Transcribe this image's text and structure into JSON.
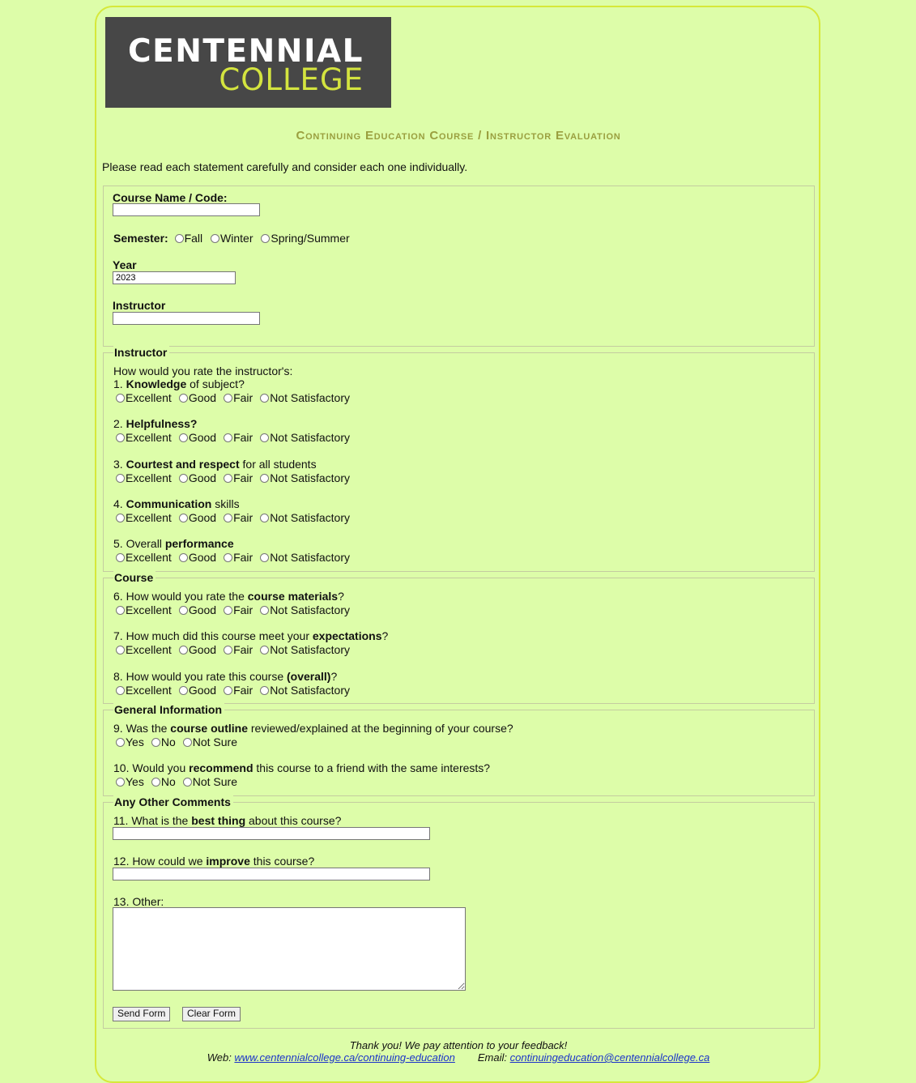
{
  "logo": {
    "line1": "CENTENNIAL",
    "line2": "COLLEGE"
  },
  "title": "Continuing Education Course / Instructor Evaluation",
  "intro": "Please read each statement carefully and consider each one individually.",
  "course_info": {
    "course_name_label": "Course Name / Code:",
    "semester_label": "Semester:",
    "semester_options": [
      "Fall",
      "Winter",
      "Spring/Summer"
    ],
    "year_label": "Year",
    "year_value": "2023",
    "instructor_label": "Instructor"
  },
  "ratings": [
    "Excellent",
    "Good",
    "Fair",
    "Not Satisfactory"
  ],
  "yes_no": [
    "Yes",
    "No",
    "Not Sure"
  ],
  "instructor_section": {
    "legend": "Instructor",
    "prompt": "How would you rate the instructor's:",
    "q1": {
      "num": "1. ",
      "bold": "Knowledge",
      "rest": " of subject?"
    },
    "q2": {
      "num": "2. ",
      "bold": "Helpfulness?",
      "rest": ""
    },
    "q3": {
      "num": "3. ",
      "bold": "Courtest and respect",
      "rest": " for all students"
    },
    "q4": {
      "num": "4. ",
      "bold": "Communication",
      "rest": " skills"
    },
    "q5": {
      "num": "5. Overall ",
      "bold": "performance",
      "rest": ""
    }
  },
  "course_section": {
    "legend": "Course",
    "q6": {
      "num": "6. How would you rate the ",
      "bold": "course materials",
      "rest": "?"
    },
    "q7": {
      "num": "7. How much did this course meet your ",
      "bold": "expectations",
      "rest": "?"
    },
    "q8": {
      "num": "8. How would you rate this course ",
      "bold": "(overall)",
      "rest": "?"
    }
  },
  "general_section": {
    "legend": "General Information",
    "q9": {
      "num": "9. Was the ",
      "bold": "course outline",
      "rest": " reviewed/explained at the beginning of your course?"
    },
    "q10": {
      "num": "10. Would you ",
      "bold": "recommend",
      "rest": " this course to a friend with the same interests?"
    }
  },
  "comments_section": {
    "legend": "Any Other Comments",
    "q11": {
      "num": "11. What is the ",
      "bold": "best thing",
      "rest": " about this course?"
    },
    "q12": {
      "num": "12. How could we ",
      "bold": "improve",
      "rest": " this course?"
    },
    "q13": "13. Other:"
  },
  "buttons": {
    "send": "Send Form",
    "clear": "Clear Form"
  },
  "footer": {
    "thanks": "Thank you! We pay attention to your feedback!",
    "web_label": "Web: ",
    "web_url": "www.centennialcollege.ca/continuing-education",
    "email_label": "Email: ",
    "email": "continuingeducation@centennialcollege.ca"
  },
  "colors": {
    "background": "#ddfda9",
    "frame": "#d6e83a",
    "title": "#9a9f3f",
    "logo_bg": "#474747",
    "logo_accent": "#d4e43f"
  }
}
